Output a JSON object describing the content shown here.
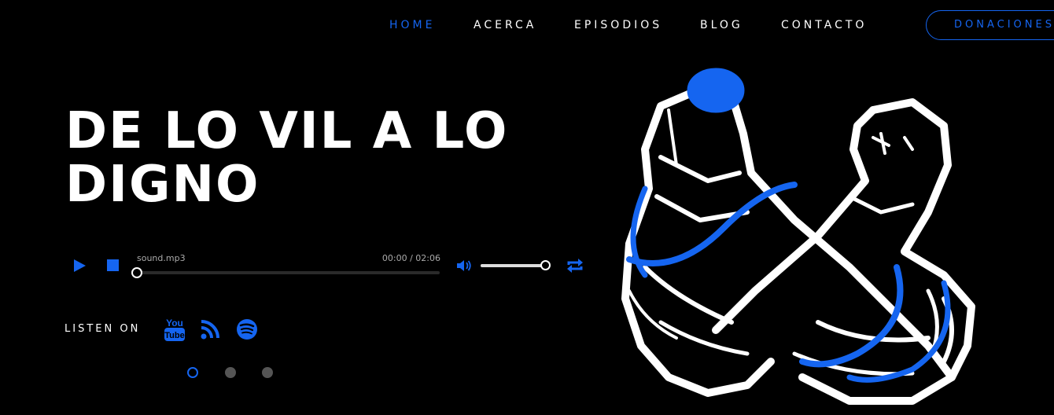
{
  "nav": {
    "items": [
      {
        "label": "HOME",
        "active": true
      },
      {
        "label": "ACERCA",
        "active": false
      },
      {
        "label": "EPISODIOS",
        "active": false
      },
      {
        "label": "BLOG",
        "active": false
      },
      {
        "label": "CONTACTO",
        "active": false
      }
    ],
    "donate_label": "DONACIONES"
  },
  "hero": {
    "title_line1": "DE LO VIL A LO",
    "title_line2": "DIGNO"
  },
  "player": {
    "filename": "sound.mp3",
    "time": "00:00 / 02:06",
    "progress": 0,
    "volume": 1.0,
    "icons": [
      "play-icon",
      "stop-icon",
      "volume-icon",
      "repeat-icon"
    ]
  },
  "listen": {
    "label": "LISTEN ON",
    "platforms": [
      "youtube-icon",
      "rss-icon",
      "spotify-icon"
    ]
  },
  "slider": {
    "count": 3,
    "active_index": 0
  },
  "colors": {
    "accent": "#1565f0",
    "background": "#000000",
    "text": "#ffffff"
  }
}
